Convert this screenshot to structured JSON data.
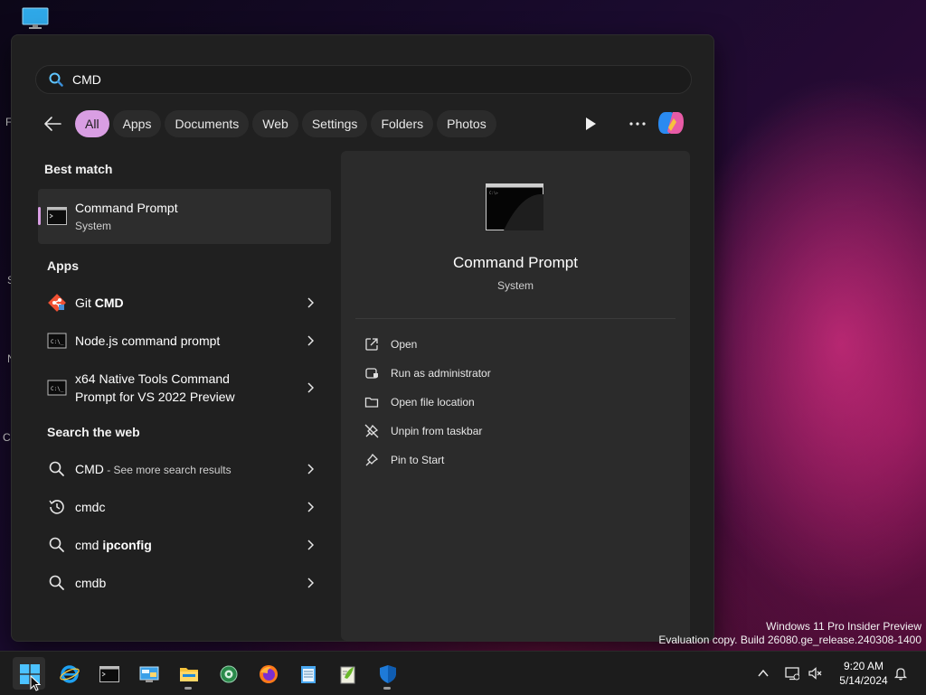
{
  "search": {
    "query": "CMD"
  },
  "filters": [
    "All",
    "Apps",
    "Documents",
    "Web",
    "Settings",
    "Folders",
    "Photos"
  ],
  "sections": {
    "best_match": "Best match",
    "apps": "Apps",
    "search_web": "Search the web"
  },
  "best_match": {
    "title": "Command Prompt",
    "subtitle": "System"
  },
  "apps": {
    "git": {
      "prefix": "Git ",
      "bold": "CMD"
    },
    "node": "Node.js command prompt",
    "x64_line1": "x64 Native Tools Command",
    "x64_line2": "Prompt for VS 2022 Preview"
  },
  "web": {
    "cmd": {
      "bold": "CMD",
      "sub": " - See more search results"
    },
    "cmdc": "cmdc",
    "ipconfig": {
      "plain": "cmd ",
      "bold": "ipconfig"
    },
    "cmdb": "cmdb"
  },
  "preview": {
    "title": "Command Prompt",
    "subtitle": "System",
    "actions": [
      "Open",
      "Run as administrator",
      "Open file location",
      "Unpin from taskbar",
      "Pin to Start"
    ]
  },
  "watermark": {
    "line1": "Windows 11 Pro Insider Preview",
    "line2": "Evaluation copy. Build 26080.ge_release.240308-1400"
  },
  "clock": {
    "time": "9:20 AM",
    "date": "5/14/2024"
  },
  "desktop_labels": [
    "F",
    "S",
    "N",
    "Co"
  ],
  "colors": {
    "accent": "#d99ee3",
    "panel": "#202020",
    "preview": "#2b2b2b",
    "taskbar": "#1c1c1c"
  }
}
